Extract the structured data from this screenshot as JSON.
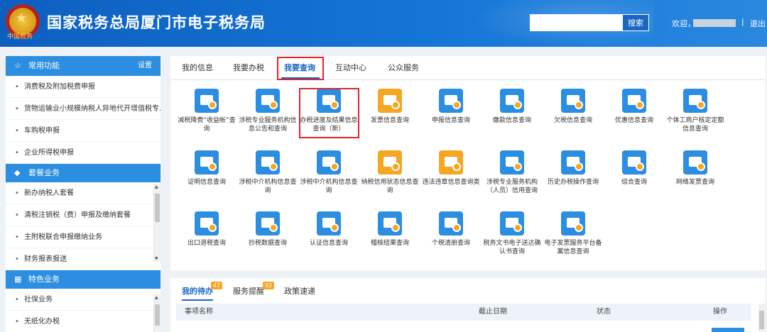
{
  "header": {
    "emblem_text": "中国税务",
    "title": "国家税务总局厦门市电子税务局",
    "search_placeholder": "",
    "search_button": "搜索",
    "welcome": "欢迎，",
    "separator": "|",
    "logout": "退出"
  },
  "sidebar": {
    "common": {
      "title": "常用功能",
      "settings": "设置",
      "items": [
        "消费税及附加税费申报",
        "货物运输业小规模纳税人异地代开增值税专...",
        "车购税申报",
        "企业所得税申报"
      ]
    },
    "package": {
      "title": "套餐业务",
      "items": [
        "新办纳税人套餐",
        "清税注销税（费）申报及缴纳套餐",
        "主附税联合申报缴纳业务",
        "财务报表报送"
      ]
    },
    "special": {
      "title": "特色业务",
      "items": [
        "社保业务",
        "无纸化办税"
      ]
    }
  },
  "main": {
    "tabs": [
      "我的信息",
      "我要办税",
      "我要查询",
      "互动中心",
      "公众服务"
    ],
    "active_tab": "我要查询",
    "items": [
      {
        "label": "减税降费“收益帐”查询",
        "color": "#2c8ee0"
      },
      {
        "label": "涉税专业服务机构信息公告和查询",
        "color": "#2c8ee0"
      },
      {
        "label": "办税进度及结果信息查询（新）",
        "color": "#2c8ee0"
      },
      {
        "label": "发票信息查询",
        "color": "#f5a623"
      },
      {
        "label": "申报信息查询",
        "color": "#2c8ee0"
      },
      {
        "label": "缴款信息查询",
        "color": "#2c8ee0"
      },
      {
        "label": "欠税信息查询",
        "color": "#2c8ee0"
      },
      {
        "label": "优惠信息查询",
        "color": "#2c8ee0"
      },
      {
        "label": "个体工商户核定定额信息查询",
        "color": "#2c8ee0"
      },
      {
        "label": "证明信息查询",
        "color": "#2c8ee0"
      },
      {
        "label": "涉税中介机构信息查询",
        "color": "#2c8ee0"
      },
      {
        "label": "涉税中介机构信息查询",
        "color": "#2c8ee0"
      },
      {
        "label": "纳税信用状态信息查询",
        "color": "#f5a623"
      },
      {
        "label": "违法违章信息查询类",
        "color": "#f5a623"
      },
      {
        "label": "涉税专业服务机构（人员）信用查询",
        "color": "#2c8ee0"
      },
      {
        "label": "历史办税操作查询",
        "color": "#2c8ee0"
      },
      {
        "label": "综合查询",
        "color": "#2c8ee0"
      },
      {
        "label": "网络发票查询",
        "color": "#2c8ee0"
      },
      {
        "label": "出口退税查询",
        "color": "#2c8ee0"
      },
      {
        "label": "抄税数据查询",
        "color": "#2c8ee0"
      },
      {
        "label": "认证信息查询",
        "color": "#2c8ee0"
      },
      {
        "label": "稽核结果查询",
        "color": "#2c8ee0"
      },
      {
        "label": "个税清册查询",
        "color": "#2c8ee0"
      },
      {
        "label": "税务文书电子送达确认书查询",
        "color": "#2c8ee0"
      },
      {
        "label": "电子发票服务平台备案信息查询",
        "color": "#2c8ee0"
      }
    ]
  },
  "bottom": {
    "tabs": [
      "我的待办",
      "服务提醒",
      "政策速递"
    ],
    "badges": [
      "47",
      "92"
    ],
    "columns": [
      "事项名称",
      "截止日期",
      "状态",
      "操作"
    ]
  },
  "colors": {
    "primary": "#1a66c2",
    "highlight": "#e0252c",
    "accent": "#f5a623"
  }
}
